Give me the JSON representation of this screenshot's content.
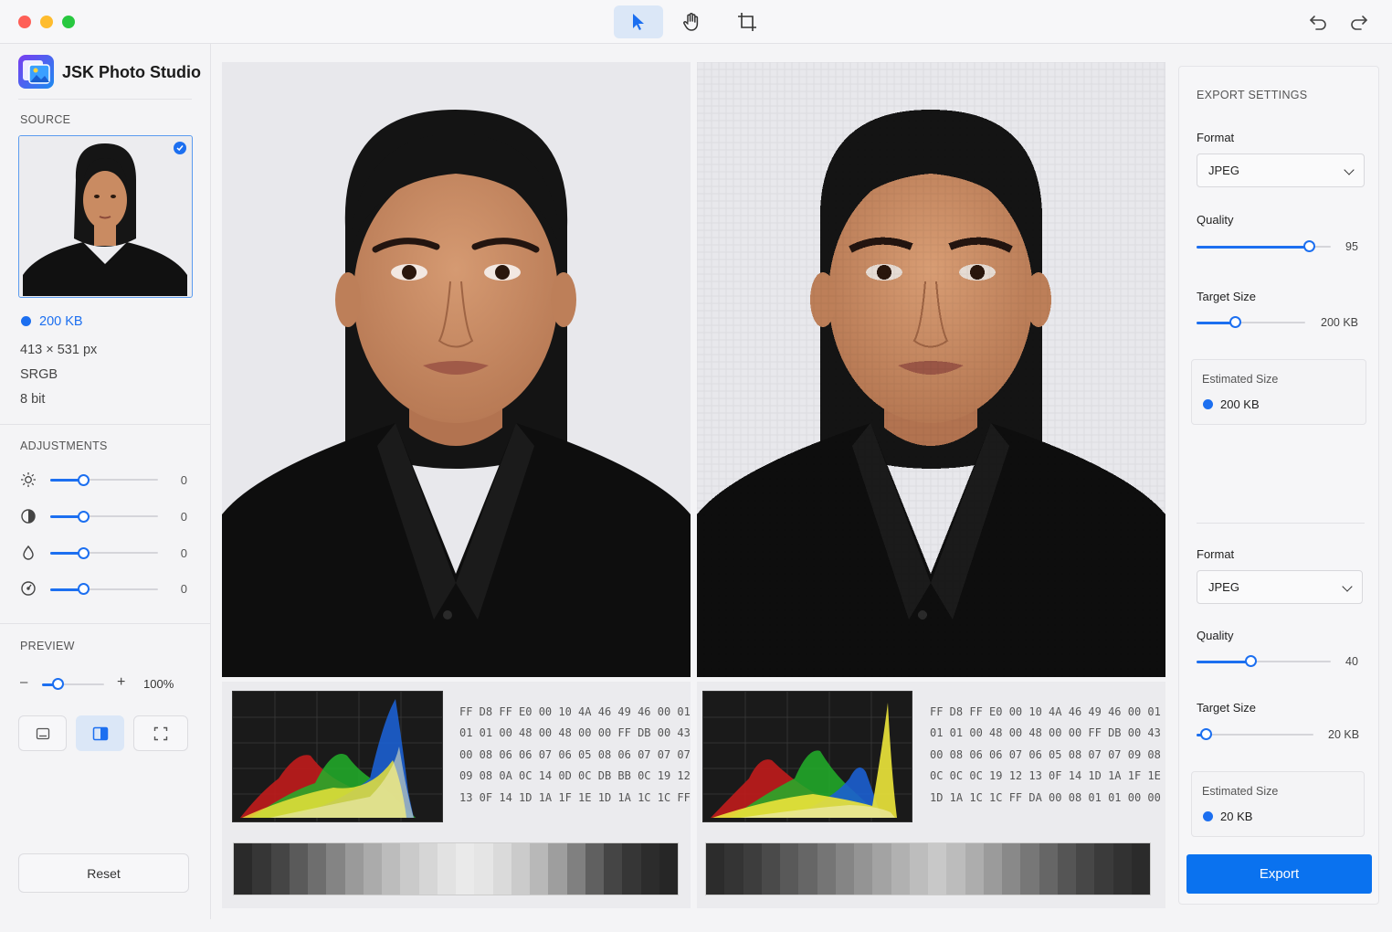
{
  "app": {
    "title": "JSK Photo Studio"
  },
  "toolbar": {
    "tools": [
      "select-tool",
      "pan-tool",
      "crop-tool"
    ],
    "undo": "undo",
    "redo": "redo"
  },
  "sidebar": {
    "source_title": "SOURCE",
    "file_size": "200 KB",
    "dimensions": "413 × 531 px",
    "color_space": "SRGB",
    "bit_depth": "8 bit",
    "adjustments_title": "ADJUSTMENTS",
    "adjustments": [
      {
        "icon": "brightness-icon",
        "value": "0"
      },
      {
        "icon": "contrast-icon",
        "value": "0"
      },
      {
        "icon": "saturation-icon",
        "value": "0"
      },
      {
        "icon": "exposure-icon",
        "value": "0"
      }
    ],
    "preview_title": "PREVIEW",
    "zoom_minus": "–",
    "zoom_plus": "+",
    "zoom": "100%",
    "reset": "Reset"
  },
  "left_pane": {
    "hex": "FF D8 FF E0 00 10 4A 46 49 46 00 01\n01 01 00 48 00 48 00 00 FF DB 00 43\n00 08 06 06 07 06 05 08 06 07 07 07\n09 08 0A 0C 14 0D 0C DB BB 0C 19 12\n13 0F 14 1D 1A 1F 1E 1D 1A 1C 1C FF",
    "swatches": [
      "#2a2a2a",
      "#363636",
      "#454545",
      "#5a5a5a",
      "#6e6e6e",
      "#848484",
      "#9a9a9a",
      "#ababab",
      "#bcbcbc",
      "#cacaca",
      "#d6d6d6",
      "#e2e2e2",
      "#eaeaea",
      "#e5e5e5",
      "#dadada",
      "#cbcbcb",
      "#b8b8b8",
      "#9e9e9e",
      "#808080",
      "#606060",
      "#454545",
      "#363636",
      "#2c2c2c",
      "#262626"
    ]
  },
  "right_pane": {
    "hex": "FF D8 FF E0 00 10 4A 46 49 46 00 01\n01 01 00 48 00 48 00 00 FF DB 00 43\n00 08 06 06 07 06 05 08 07 07 09 08\n0C 0C 0C 19 12 13 0F 14 1D 1A 1F 1E\n1D 1A 1C 1C FF DA 00 08 01 01 00 00",
    "swatches": [
      "#2c2c2c",
      "#343434",
      "#3d3d3d",
      "#4a4a4a",
      "#595959",
      "#666666",
      "#757575",
      "#858585",
      "#949494",
      "#a3a3a3",
      "#b1b1b1",
      "#bdbdbd",
      "#c8c8c8",
      "#bcbcbc",
      "#adadad",
      "#9b9b9b",
      "#898989",
      "#777777",
      "#666666",
      "#555555",
      "#474747",
      "#3b3b3b",
      "#323232",
      "#2b2b2b"
    ]
  },
  "export": {
    "title": "EXPORT SETTINGS",
    "a": {
      "format_label": "Format",
      "format": "JPEG",
      "quality_label": "Quality",
      "quality": "95",
      "quality_frac": 0.84,
      "target_label": "Target Size",
      "target": "200 KB",
      "target_frac": 0.35,
      "est_label": "Estimated Size",
      "est": "200 KB"
    },
    "b": {
      "format_label": "Format",
      "format": "JPEG",
      "quality_label": "Quality",
      "quality": "40",
      "quality_frac": 0.4,
      "target_label": "Target Size",
      "target": "20 KB",
      "target_frac": 0.08,
      "est_label": "Estimated Size",
      "est": "20 KB"
    },
    "button": "Export"
  },
  "colors": {
    "accent": "#1c6ff0",
    "export_button": "#0a72ef"
  }
}
